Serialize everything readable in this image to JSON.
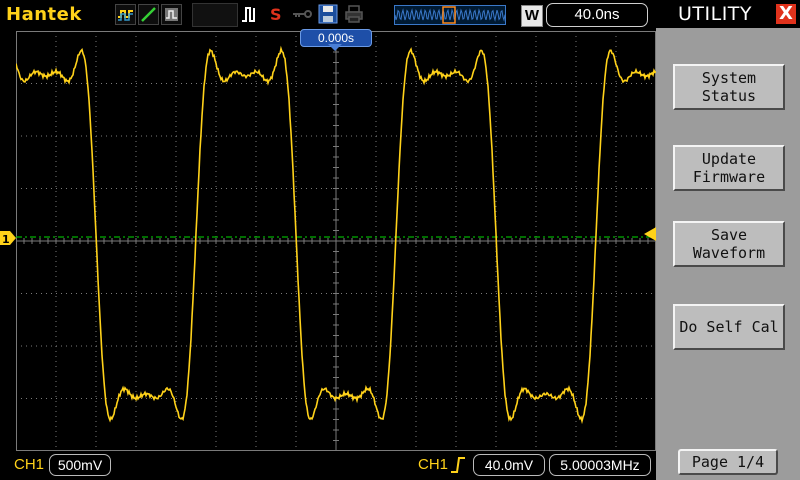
{
  "header": {
    "brand": "Hantek",
    "timebase": "40.0ns",
    "w_badge": "W",
    "trigger_position": "0.000s"
  },
  "icons": {
    "mode": [
      "square-wave-icon",
      "ramp-icon",
      "persist-icon"
    ],
    "status": [
      "pulse-icon",
      "stop-s-icon",
      "key-icon",
      "save-disk-icon",
      "printer-icon"
    ],
    "ch1_marker": "ch1-ground-marker-icon",
    "trigger_level": "trigger-level-marker-icon",
    "trigger_edge": "rising-edge-icon",
    "close": "close-icon"
  },
  "colors": {
    "trace": "#ffd21a",
    "grid": "#7a7a7a",
    "menu_bg": "#9c9c9c",
    "close": "#e0321c",
    "trigger_line": "#00b000"
  },
  "footer": {
    "ch1_label": "CH1",
    "ch1_scale": "500mV",
    "trig_source": "CH1",
    "trig_level": "40.0mV",
    "frequency": "5.00003MHz"
  },
  "menu": {
    "title": "UTILITY",
    "close_label": "X",
    "buttons": [
      {
        "lines": [
          "System",
          "Status"
        ]
      },
      {
        "lines": [
          "Update",
          "Firmware"
        ]
      },
      {
        "lines": [
          "Save",
          "Waveform"
        ]
      },
      {
        "lines": [
          "Do Self Cal"
        ]
      }
    ],
    "page": "Page 1/4"
  },
  "chart_data": {
    "type": "line",
    "divisions_x": 16,
    "divisions_y": 8,
    "grid": true,
    "series": [
      {
        "waveform": "square-like",
        "frequency": "5.00003MHz",
        "channel_scale": "500mV",
        "timebase": "40.0ns"
      }
    ]
  }
}
